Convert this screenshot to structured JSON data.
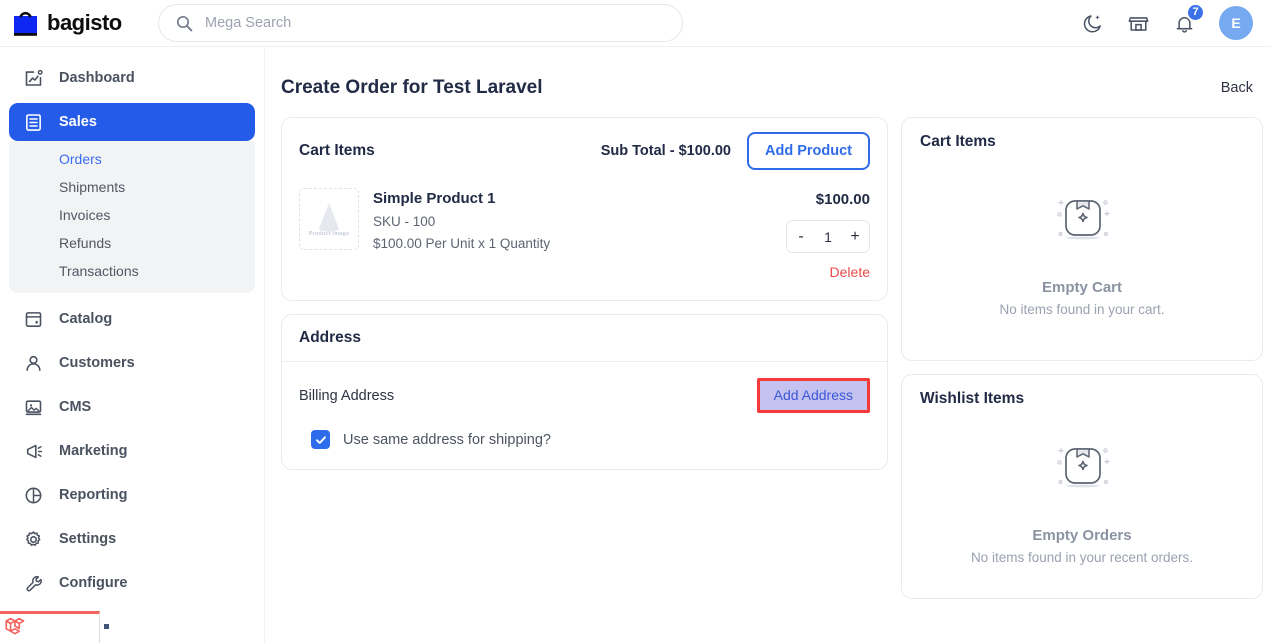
{
  "topbar": {
    "brand_name": "bagisto",
    "brand_logo_icon": "shopping-bag-icon",
    "search": {
      "placeholder": "Mega Search",
      "value": "",
      "icon": "search-icon"
    },
    "actions": {
      "dark_mode_icon": "moon-star-icon",
      "store_icon": "storefront-icon",
      "notifications_icon": "bell-icon",
      "notifications_count": "7",
      "avatar_initial": "E"
    }
  },
  "sidebar": {
    "items": [
      {
        "label": "Dashboard",
        "icon": "chart-square-icon",
        "active": false
      },
      {
        "label": "Sales",
        "icon": "list-document-icon",
        "active": true
      },
      {
        "label": "Catalog",
        "icon": "catalog-window-icon",
        "active": false
      },
      {
        "label": "Customers",
        "icon": "user-icon",
        "active": false
      },
      {
        "label": "CMS",
        "icon": "image-frame-icon",
        "active": false
      },
      {
        "label": "Marketing",
        "icon": "megaphone-icon",
        "active": false
      },
      {
        "label": "Reporting",
        "icon": "pie-chart-icon",
        "active": false
      },
      {
        "label": "Settings",
        "icon": "gear-icon",
        "active": false
      },
      {
        "label": "Configure",
        "icon": "wrench-icon",
        "active": false
      }
    ],
    "submenu": [
      {
        "label": "Orders",
        "active": true
      },
      {
        "label": "Shipments",
        "active": false
      },
      {
        "label": "Invoices",
        "active": false
      },
      {
        "label": "Refunds",
        "active": false
      },
      {
        "label": "Transactions",
        "active": false
      }
    ],
    "debugbar_icon": "laravel-logo-icon"
  },
  "page": {
    "title": "Create Order for Test Laravel",
    "back_label": "Back"
  },
  "cart_card": {
    "title": "Cart Items",
    "sub_total": "Sub Total - $100.00",
    "add_product_label": "Add Product",
    "item": {
      "image_placeholder_label": "Product Image",
      "name": "Simple Product 1",
      "sku": "SKU - 100",
      "price_line": "$100.00 Per Unit x 1 Quantity",
      "line_total": "$100.00",
      "qty_decrement": "-",
      "qty_value": "1",
      "qty_increment": "+",
      "delete_label": "Delete"
    }
  },
  "address_card": {
    "title": "Address",
    "billing_label": "Billing Address",
    "add_address_label": "Add Address",
    "same_address_label": "Use same address for shipping?",
    "same_address_checked": true,
    "highlight_color": "#f63a3a"
  },
  "side_cart_card": {
    "title": "Cart Items",
    "empty_icon": "empty-box-plus-icon",
    "empty_title": "Empty Cart",
    "empty_subtitle": "No items found in your cart."
  },
  "side_wishlist_card": {
    "title": "Wishlist Items",
    "empty_icon": "empty-box-plus-icon",
    "empty_title": "Empty Orders",
    "empty_subtitle": "No items found in your recent orders."
  },
  "colors": {
    "accent_blue": "#245ce9",
    "link_blue": "#2f6ceb",
    "danger_red": "#ee4b4b",
    "highlight_red": "#f63a3a",
    "highlight_fill": "#c5c2f0"
  }
}
